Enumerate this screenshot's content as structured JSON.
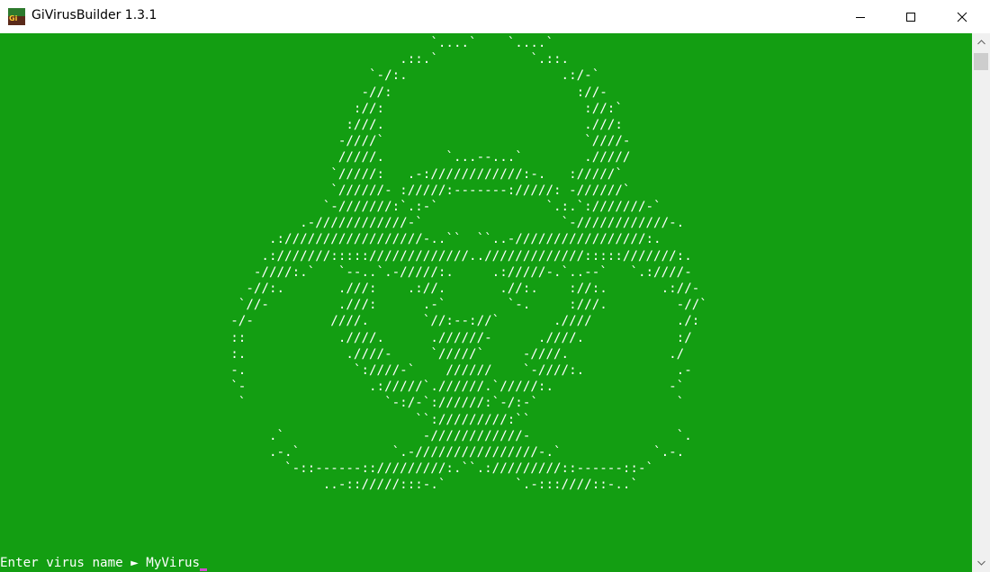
{
  "window": {
    "title": "GiVirusBuilder 1.3.1",
    "app_icon_text": "Gi"
  },
  "console": {
    "background": "#139e12",
    "text_color": "#ffffff",
    "art": "                                                        `....`    `....`\n                                                    .::.`            `.::.\n                                                `-/:.                    .:/-`\n                                               -//:                        ://-\n                                              ://:                          ://:`\n                                             :///.                          .///:\n                                            -////`                          `////-\n                                            /////.        `...--...`        ./////\n                                           `/////:   .-:////////////:-.   ://///`\n                                           `//////- ://///:-------://///: -//////`\n                                          `-///////:`.:-`              `.:.`:///////-`\n                                       .-////////////-`                  `-////////////-.\n                                   .://////////////////-..``  ``..-/////////////////:.\n                                  .:///////::::://///////////../////////////:::::///////:.\n                                 -////:.`   `--..`.-/////:.     .://///-.`..--`   `.:////-\n                                -//:.       .///:    .://.       .//:.    ://:.       .://-\n                               `//-         .///:      .-`        `-.     :///.         -//`\n                              -/-          ////.       `//:--://`       .////           ./:\n                              ::            .////.      .//////-      .////.            :/\n                              :.             .////-     `/////`     -////.             ./\n                              -.              `:////-`    //////    `-////:.            .-\n                              `-                .://///`.//////.`/////:.               -`\n                               `                  `-:/-`://////:`-/:-`                  `\n                                                      ``://///////:``\n                                   .`                  -////////////-                   `.\n                                   .-.`            `.-////////////////-.`            `.-.\n                                     `-::------:://///////:.``.://///////::------::-`\n                                          ..-:://///:::-.`         `.-:::////::-..`",
    "prompt_label": "Enter virus name ► ",
    "input_value": "MyVirus"
  },
  "icons": {
    "minimize": "minimize-icon",
    "maximize": "maximize-icon",
    "close": "close-icon",
    "scroll_up": "chevron-up-icon",
    "scroll_down": "chevron-down-icon"
  }
}
